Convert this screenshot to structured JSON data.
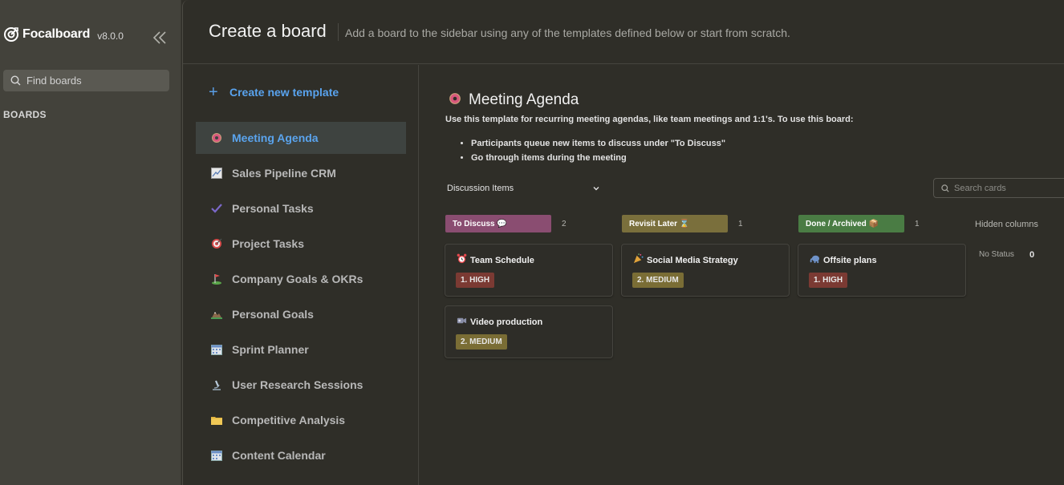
{
  "colors": {
    "accent": "#5aa4ee",
    "sidebar_bg": "#43423b",
    "main_bg": "#2f2e28",
    "to_discuss": "#8a4d71",
    "revisit_later": "#7a6f3c",
    "done_archived": "#4a7c44",
    "high": "#7b3a33",
    "medium": "#7a6d35"
  },
  "sidebar": {
    "brand_name": "Focalboard",
    "version": "v8.0.0",
    "find_boards_label": "Find boards",
    "boards_title": "BOARDS"
  },
  "header": {
    "title": "Create a board",
    "description": "Add a board to the sidebar using any of the templates defined below or start from scratch."
  },
  "templates": {
    "create_label": "Create new template",
    "items": [
      {
        "label": "Meeting Agenda",
        "icon": "donut-icon",
        "active": true
      },
      {
        "label": "Sales Pipeline CRM",
        "icon": "chart-icon"
      },
      {
        "label": "Personal Tasks",
        "icon": "checkmark-icon"
      },
      {
        "label": "Project Tasks",
        "icon": "target-icon"
      },
      {
        "label": "Company Goals & OKRs",
        "icon": "golf-icon"
      },
      {
        "label": "Personal Goals",
        "icon": "mountain-icon"
      },
      {
        "label": "Sprint Planner",
        "icon": "calendar-icon"
      },
      {
        "label": "User Research Sessions",
        "icon": "microscope-icon"
      },
      {
        "label": "Competitive Analysis",
        "icon": "folder-icon"
      },
      {
        "label": "Content Calendar",
        "icon": "calendar-icon"
      }
    ]
  },
  "preview": {
    "title": "Meeting Agenda",
    "title_icon": "donut-icon",
    "description": "Use this template for recurring meeting agendas, like team meetings and 1:1's. To use this board:",
    "bullets": [
      "Participants queue new items to discuss under \"To Discuss\"",
      "Go through items during the meeting"
    ],
    "view_name": "Discussion Items",
    "search_placeholder": "Search cards",
    "columns": [
      {
        "label": "To Discuss 💬",
        "count": "2"
      },
      {
        "label": "Revisit Later ⌛",
        "count": "1"
      },
      {
        "label": "Done / Archived 📦",
        "count": "1"
      }
    ],
    "hidden_columns_label": "Hidden columns",
    "no_status_label": "No Status",
    "no_status_count": "0",
    "cards": [
      {
        "title": "Team Schedule",
        "icon": "alarm-clock-icon",
        "badge": "1. HIGH"
      },
      {
        "title": "Social Media Strategy",
        "icon": "party-popper-icon",
        "badge": "2. MEDIUM"
      },
      {
        "title": "Offsite plans",
        "icon": "elephant-icon",
        "badge": "1. HIGH"
      },
      {
        "title": "Video production",
        "icon": "video-camera-icon",
        "badge": "2. MEDIUM"
      }
    ]
  }
}
